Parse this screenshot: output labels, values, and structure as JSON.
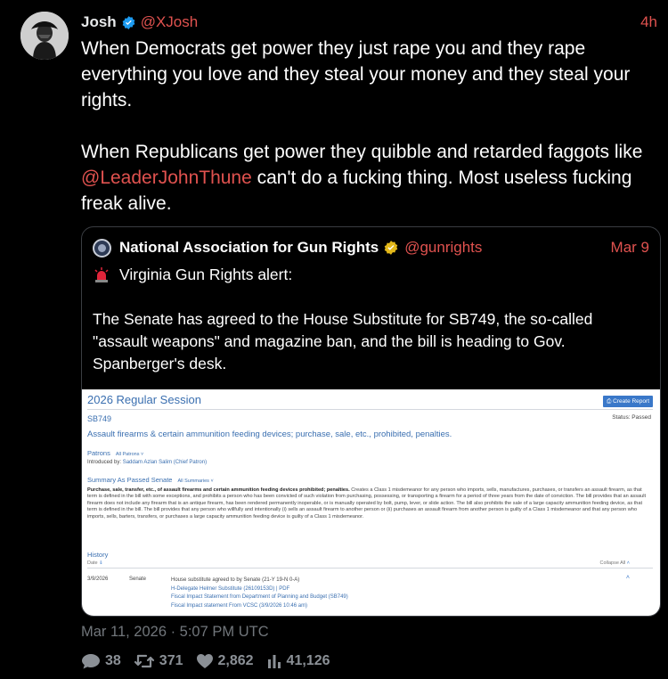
{
  "tweet": {
    "name": "Josh",
    "handle": "@XJosh",
    "time": "4h",
    "text_p1": "When Democrats get power they just rape you and they rape everything you love and they steal your money and they steal your rights.",
    "text_p2_before": "When Republicans get power they quibble and retarded faggots like ",
    "text_p2_mention": "@LeaderJohnThune",
    "text_p2_after": " can't do a fucking thing. Most useless fucking freak alive.",
    "timestamp": "Mar 11, 2026 · 5:07 PM UTC",
    "stats": {
      "replies": "38",
      "retweets": "371",
      "likes": "2,862",
      "views": "41,126"
    }
  },
  "quote": {
    "name": "National Association for Gun Rights",
    "handle": "@gunrights",
    "date": "Mar 9",
    "alert": "Virginia Gun Rights alert:",
    "text": "The Senate has agreed to the House Substitute for SB749, the so-called \"assault weapons\" and magazine ban, and the bill is heading to Gov. Spanberger's desk."
  },
  "screenshot": {
    "title": "2026 Regular Session",
    "create_report": "Create Report",
    "bill": "SB749",
    "status": "Status: Passed",
    "subject": "Assault firearms & certain ammunition feeding devices; purchase, sale, etc., prohibited, penalties.",
    "patrons_label": "Patrons",
    "all_patrons": "All Patrons",
    "introduced_by_label": "Introduced by:",
    "introduced_by": "Saddam Azlan Salim (Chief Patron)",
    "summary_label": "Summary As Passed Senate",
    "all_summaries": "All Summaries",
    "summary_bold": "Purchase, sale, transfer, etc., of assault firearms and certain ammunition feeding devices prohibited; penalties.",
    "summary_text": " Creates a Class 1 misdemeanor for any person who imports, sells, manufactures, purchases, or transfers an assault firearm, as that term is defined in the bill with some exceptions, and prohibits a person who has been convicted of such violation from purchasing, possessing, or transporting a firearm for a period of three years from the date of conviction. The bill provides that an assault firearm does not include any firearm that is an antique firearm, has been rendered permanently inoperable, or is manually operated by bolt, pump, lever, or slide action. The bill also prohibits the sale of a large capacity ammunition feeding device, as that term is defined in the bill. The bill provides that any person who willfully and intentionally (i) sells an assault firearm to another person or (ii) purchases an assault firearm from another person is guilty of a Class 1 misdemeanor and that any person who imports, sells, barters, transfers, or purchases a large capacity ammunition feeding device is guilty of a Class 1 misdemeanor.",
    "history_label": "History",
    "date_label": "Date",
    "collapse_all": "Collapse All",
    "row_date": "3/9/2026",
    "row_chamber": "Senate",
    "row_action": "House substitute agreed to by Senate (21-Y 19-N 0-A)",
    "row_link1": "H-Delegate Helmer Substitute (26109153D) | PDF",
    "row_link2": "Fiscal Impact Statement from Department of Planning and Budget (SB749)",
    "row_link3": "Fiscal Impact statement From VCSC (3/9/2026 10:46 am)"
  },
  "colors": {
    "accent": "#e0524f",
    "verified_blue": "#1d9bf0",
    "verified_gold": "#e2b719",
    "background": "#000000",
    "muted": "#71767b"
  }
}
